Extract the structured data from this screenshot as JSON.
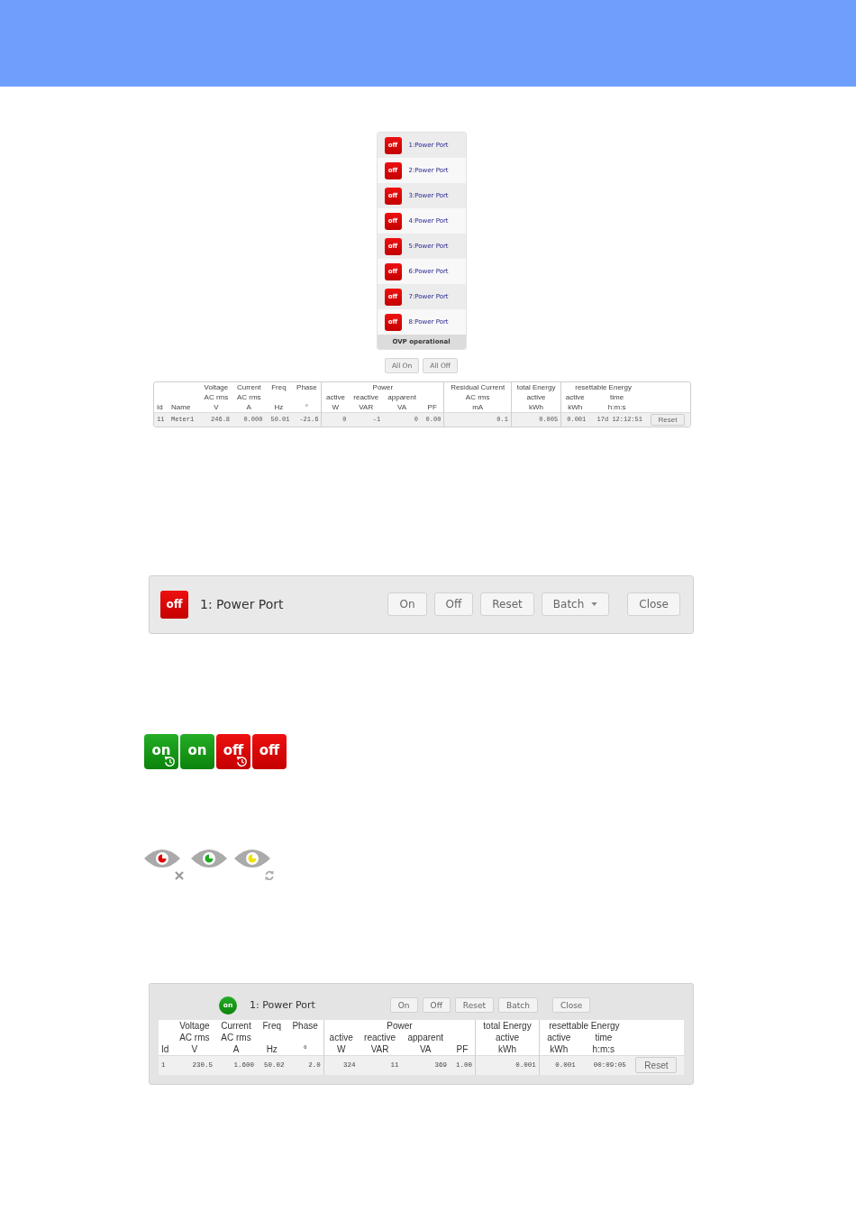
{
  "port_panel": {
    "ports": [
      {
        "state": "off",
        "label": "1:Power Port"
      },
      {
        "state": "off",
        "label": "2:Power Port"
      },
      {
        "state": "off",
        "label": "3:Power Port"
      },
      {
        "state": "off",
        "label": "4:Power Port"
      },
      {
        "state": "off",
        "label": "5:Power Port"
      },
      {
        "state": "off",
        "label": "6:Power Port"
      },
      {
        "state": "off",
        "label": "7:Power Port"
      },
      {
        "state": "off",
        "label": "8:Power Port"
      }
    ],
    "status": "OVP operational",
    "buttons": [
      "All On",
      "All Off"
    ]
  },
  "meter_table": {
    "sections": [
      {
        "columns": [
          {
            "label": "Id",
            "kind": "text"
          },
          {
            "label": "Name",
            "kind": "text"
          },
          {
            "title": "Voltage",
            "subtitle": "AC rms",
            "label": "V",
            "kind": "number"
          },
          {
            "title": "Current",
            "subtitle": "AC rms",
            "label": "A",
            "kind": "number"
          },
          {
            "title": "Freq",
            "label": "Hz",
            "kind": "number"
          },
          {
            "title": "Phase",
            "label": "°",
            "kind": "number"
          }
        ]
      },
      {
        "title": "Power",
        "columns": [
          {
            "subtitle": "active",
            "label": "W",
            "kind": "number"
          },
          {
            "subtitle": "reactive",
            "label": "VAR",
            "kind": "number"
          },
          {
            "subtitle": "apparent",
            "label": "VA",
            "kind": "number"
          },
          {
            "label": "PF",
            "kind": "number"
          }
        ]
      },
      {
        "columns": [
          {
            "title": "Residual Current",
            "subtitle": "AC rms",
            "label": "mA",
            "kind": "number"
          }
        ]
      },
      {
        "columns": [
          {
            "title": "total Energy",
            "subtitle": "active",
            "label": "kWh",
            "kind": "number"
          }
        ]
      },
      {
        "title": "resettable Energy",
        "columns": [
          {
            "subtitle": "active",
            "label": "kWh",
            "kind": "number"
          },
          {
            "subtitle": "time",
            "label": "h:m:s",
            "kind": "number"
          }
        ]
      }
    ],
    "rows": [
      {
        "cells": [
          "11",
          "Meter1",
          "246.8",
          "0.000",
          "50.01",
          "-21.6",
          "0",
          "-1",
          "0",
          "0.00",
          "0.1",
          "0.005",
          "0.001",
          "17d 12:12:51"
        ],
        "button": "Reset"
      }
    ]
  },
  "port_dialog": {
    "state": "off",
    "title": "1: Power Port",
    "buttons": [
      {
        "label": "On"
      },
      {
        "label": "Off"
      },
      {
        "label": "Reset"
      },
      {
        "label": "Batch",
        "dropdown": true
      },
      {
        "label": "Close"
      }
    ]
  },
  "state_badges": [
    {
      "state": "on",
      "scheduled": true
    },
    {
      "state": "on",
      "scheduled": false
    },
    {
      "state": "off",
      "scheduled": true
    },
    {
      "state": "off",
      "scheduled": false
    }
  ],
  "eye_icons": [
    {
      "kind": "cross",
      "color": "#e00000"
    },
    {
      "kind": "plain",
      "color": "#1fa81f"
    },
    {
      "kind": "refresh",
      "color": "#f2e200"
    }
  ],
  "port_window": {
    "state": "on",
    "title": "1: Power Port",
    "buttons": [
      {
        "label": "On"
      },
      {
        "label": "Off"
      },
      {
        "label": "Reset"
      },
      {
        "label": "Batch"
      },
      {
        "label": "Close"
      }
    ],
    "table": {
      "sections": [
        {
          "columns": [
            {
              "label": "Id",
              "kind": "text"
            },
            {
              "title": "Voltage",
              "subtitle": "AC rms",
              "label": "V",
              "kind": "number"
            },
            {
              "title": "Current",
              "subtitle": "AC rms",
              "label": "A",
              "kind": "number"
            },
            {
              "title": "Freq",
              "label": "Hz",
              "kind": "number"
            },
            {
              "title": "Phase",
              "label": "°",
              "kind": "number"
            }
          ]
        },
        {
          "title": "Power",
          "columns": [
            {
              "subtitle": "active",
              "label": "W",
              "kind": "number"
            },
            {
              "subtitle": "reactive",
              "label": "VAR",
              "kind": "number"
            },
            {
              "subtitle": "apparent",
              "label": "VA",
              "kind": "number"
            },
            {
              "label": "PF",
              "kind": "number"
            }
          ]
        },
        {
          "columns": [
            {
              "title": "total Energy",
              "subtitle": "active",
              "label": "kWh",
              "kind": "number"
            }
          ]
        },
        {
          "title": "resettable Energy",
          "columns": [
            {
              "subtitle": "active",
              "label": "kWh",
              "kind": "number"
            },
            {
              "subtitle": "time",
              "label": "h:m:s",
              "kind": "number"
            }
          ]
        }
      ],
      "rows": [
        {
          "cells": [
            "1",
            "230.5",
            "1.600",
            "50.02",
            "2.0",
            "324",
            "11",
            "369",
            "1.00",
            "0.001",
            "0.001",
            "00:09:05"
          ],
          "button": "Reset"
        }
      ]
    }
  }
}
